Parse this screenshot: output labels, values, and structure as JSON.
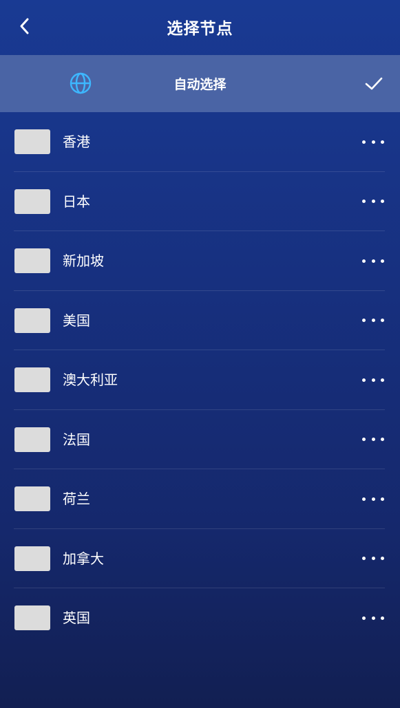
{
  "header": {
    "title": "选择节点",
    "back_icon": "chevron-left-icon"
  },
  "auto_select": {
    "label": "自动选择",
    "icon": "globe-icon",
    "icon_color": "#3db7ff",
    "selected": true,
    "selected_icon": "checkmark-icon"
  },
  "nodes": [
    {
      "name": "香港"
    },
    {
      "name": "日本"
    },
    {
      "name": "新加坡"
    },
    {
      "name": "美国"
    },
    {
      "name": "澳大利亚"
    },
    {
      "name": "法国"
    },
    {
      "name": "荷兰"
    },
    {
      "name": "加拿大"
    },
    {
      "name": "英国"
    }
  ],
  "colors": {
    "background_top": "#193a93",
    "background_bottom": "#121f52",
    "auto_row_bg": "#4a64a5",
    "flag_placeholder": "#dcdcdc"
  }
}
